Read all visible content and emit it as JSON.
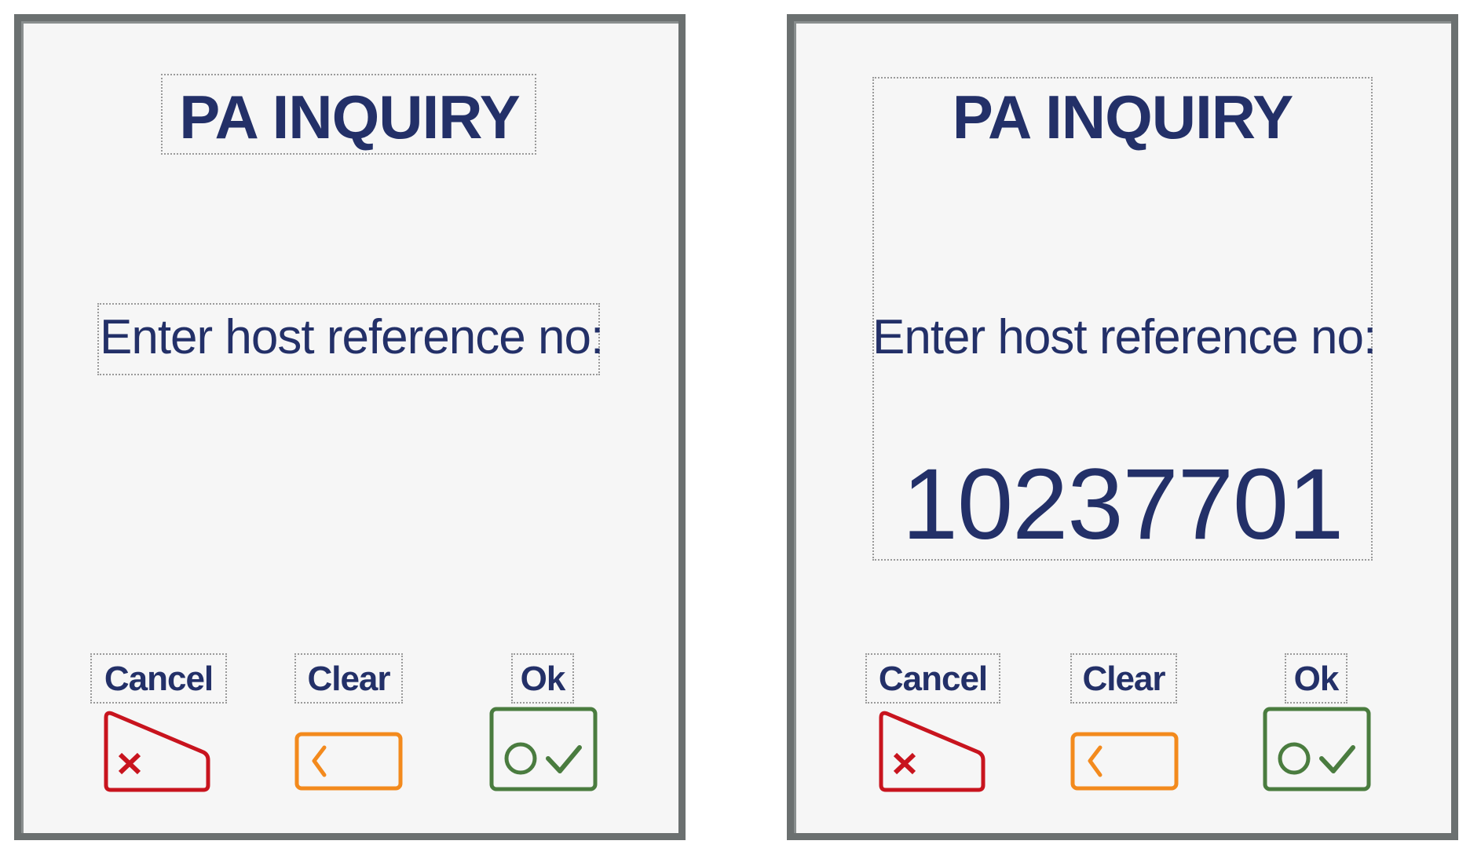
{
  "colors": {
    "text": "#233068",
    "cancel": "#c8141e",
    "clear": "#f38a1d",
    "ok": "#4a7c3f",
    "panel_border": "#6b7070",
    "panel_bg": "#f6f6f6"
  },
  "screens": [
    {
      "title": "PA INQUIRY",
      "prompt": "Enter host reference no:",
      "reference_number": "",
      "buttons": {
        "cancel": {
          "label": "Cancel",
          "icon": "cancel-x-icon"
        },
        "clear": {
          "label": "Clear",
          "icon": "backspace-chevron-icon"
        },
        "ok": {
          "label": "Ok",
          "icon": "ok-circle-check-icon"
        }
      }
    },
    {
      "title": "PA INQUIRY",
      "prompt": "Enter host reference no:",
      "reference_number": "10237701",
      "buttons": {
        "cancel": {
          "label": "Cancel",
          "icon": "cancel-x-icon"
        },
        "clear": {
          "label": "Clear",
          "icon": "backspace-chevron-icon"
        },
        "ok": {
          "label": "Ok",
          "icon": "ok-circle-check-icon"
        }
      }
    }
  ]
}
